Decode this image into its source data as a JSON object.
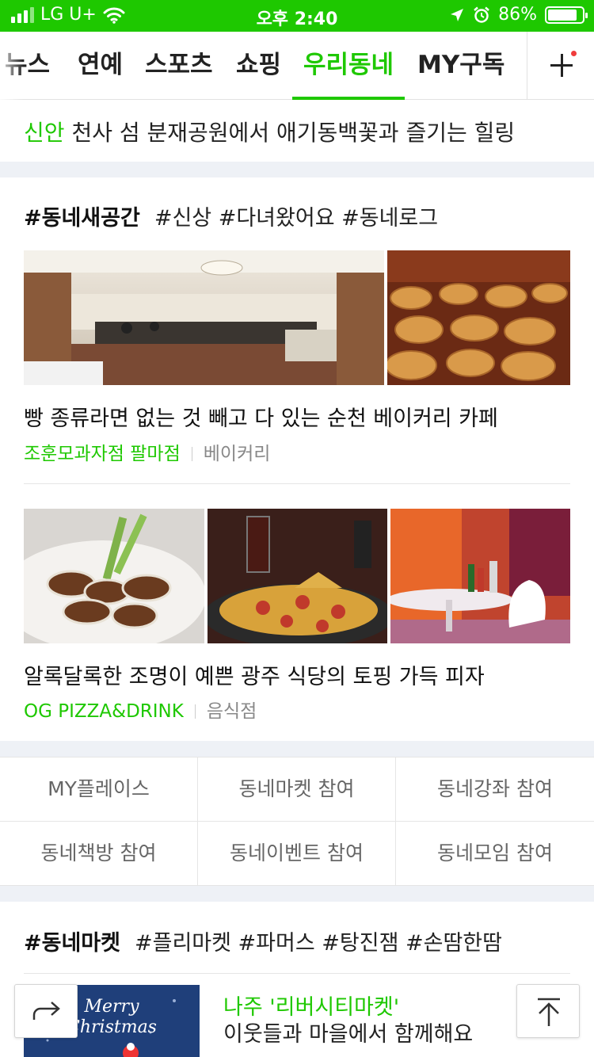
{
  "status_bar": {
    "carrier": "LG U+",
    "time": "오후 2:40",
    "battery_percent": "86%",
    "battery_level": 0.86
  },
  "tabs": [
    {
      "label": "뉴스",
      "active": false
    },
    {
      "label": "연예",
      "active": false
    },
    {
      "label": "스포츠",
      "active": false
    },
    {
      "label": "쇼핑",
      "active": false
    },
    {
      "label": "우리동네",
      "active": true
    },
    {
      "label": "MY구독",
      "active": false
    }
  ],
  "headline": {
    "region": "신안",
    "text": "천사 섬 분재공원에서 애기동백꽃과 즐기는 힐링"
  },
  "new_space": {
    "title": "#동네새공간",
    "tags": "#신상 #다녀왔어요 #동네로그",
    "cards": [
      {
        "title": "빵 종류라면 없는 것 빼고 다 있는 순천 베이커리 카페",
        "store": "조훈모과자점 팔마점",
        "category": "베이커리"
      },
      {
        "title": "알록달록한 조명이 예쁜 광주 식당의 토핑 가득 피자",
        "store": "OG PIZZA&DRINK",
        "category": "음식점"
      }
    ]
  },
  "quick_links": [
    "MY플레이스",
    "동네마켓 참여",
    "동네강좌 참여",
    "동네책방 참여",
    "동네이벤트 참여",
    "동네모임 참여"
  ],
  "market": {
    "title": "#동네마켓",
    "tags": "#플리마켓 #파머스 #탕진잼 #손땀한땀",
    "item": {
      "region": "나주 '리버시티마켓'",
      "text": "이웃들과 마을에서 함께해요",
      "thumb_text_1": "Merry",
      "thumb_text_2": "Christmas"
    }
  },
  "colors": {
    "brand_green": "#1ec800",
    "notification_dot": "#f03c3c"
  }
}
